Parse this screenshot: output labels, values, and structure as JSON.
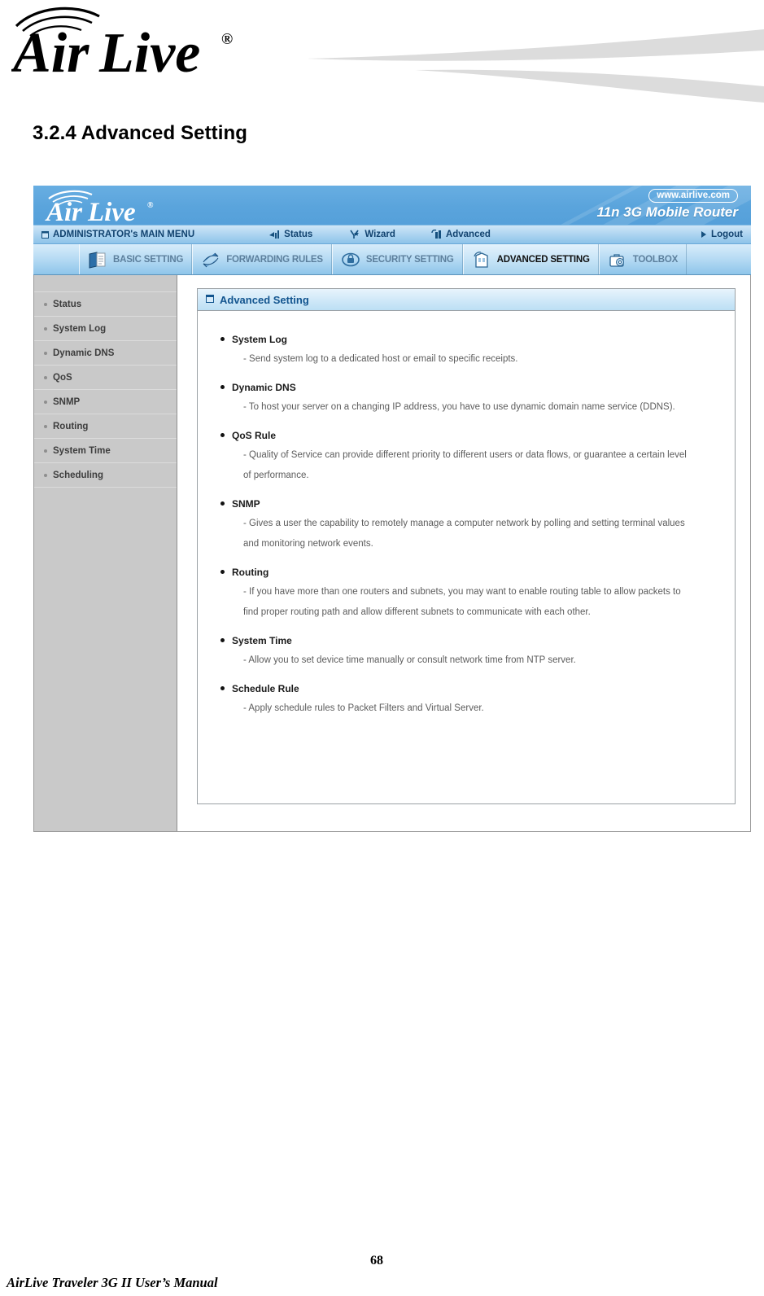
{
  "document": {
    "section_heading": "3.2.4 Advanced Setting",
    "footer_title": "AirLive Traveler 3G II User’s Manual",
    "page_number": "68",
    "brand_logo_text": "Air Live"
  },
  "router_ui": {
    "banner": {
      "logo_text": "Air Live",
      "web_url": "www.airlive.com",
      "model": "11n 3G Mobile Router"
    },
    "nav": [
      {
        "label": "ADMINISTRATOR's MAIN MENU",
        "icon": "window-icon"
      },
      {
        "label": "Status",
        "icon": "signal-bars-icon"
      },
      {
        "label": "Wizard",
        "icon": "wand-icon"
      },
      {
        "label": "Advanced",
        "icon": "tower-icon"
      },
      {
        "label": "Logout",
        "icon": "arrow-right-icon"
      }
    ],
    "tabs": [
      {
        "label": "BASIC SETTING",
        "icon": "documents-icon",
        "active": false
      },
      {
        "label": "FORWARDING RULES",
        "icon": "arrows-icon",
        "active": false
      },
      {
        "label": "SECURITY SETTING",
        "icon": "lock-shield-icon",
        "active": false
      },
      {
        "label": "ADVANCED SETTING",
        "icon": "building-icon",
        "active": true
      },
      {
        "label": "TOOLBOX",
        "icon": "toolbox-icon",
        "active": false
      }
    ],
    "sidebar": [
      {
        "label": "Status"
      },
      {
        "label": "System Log"
      },
      {
        "label": "Dynamic DNS"
      },
      {
        "label": "QoS"
      },
      {
        "label": "SNMP"
      },
      {
        "label": "Routing"
      },
      {
        "label": "System Time"
      },
      {
        "label": "Scheduling"
      }
    ],
    "panel": {
      "title": "Advanced Setting",
      "title_icon": "window-icon",
      "items": [
        {
          "name": "System Log",
          "desc": "- Send system log to a dedicated host or email to specific receipts."
        },
        {
          "name": "Dynamic DNS",
          "desc": "- To host your server on a changing IP address, you have to use dynamic domain name service (DDNS)."
        },
        {
          "name": "QoS Rule",
          "desc": "- Quality of Service can provide different priority to different users or data flows, or guarantee a certain level of performance."
        },
        {
          "name": "SNMP",
          "desc": "- Gives a user the capability to remotely manage a computer network by polling and setting terminal values and monitoring network events."
        },
        {
          "name": "Routing",
          "desc": "- If you have more than one routers and subnets, you may want to enable routing table to allow packets to find proper routing path and allow different subnets to communicate with each other."
        },
        {
          "name": "System Time",
          "desc": "- Allow you to set device time manually or consult network time from NTP server."
        },
        {
          "name": "Schedule Rule",
          "desc": "- Apply schedule rules to Packet Filters and Virtual Server."
        }
      ]
    }
  },
  "colors": {
    "banner_blue": "#5aa4dc",
    "nav_blue": "#b4d8f2",
    "panel_title_blue": "#13558f",
    "sidebar_gray": "#c9c9c9",
    "swoosh_gray": "#dcdcdc"
  }
}
